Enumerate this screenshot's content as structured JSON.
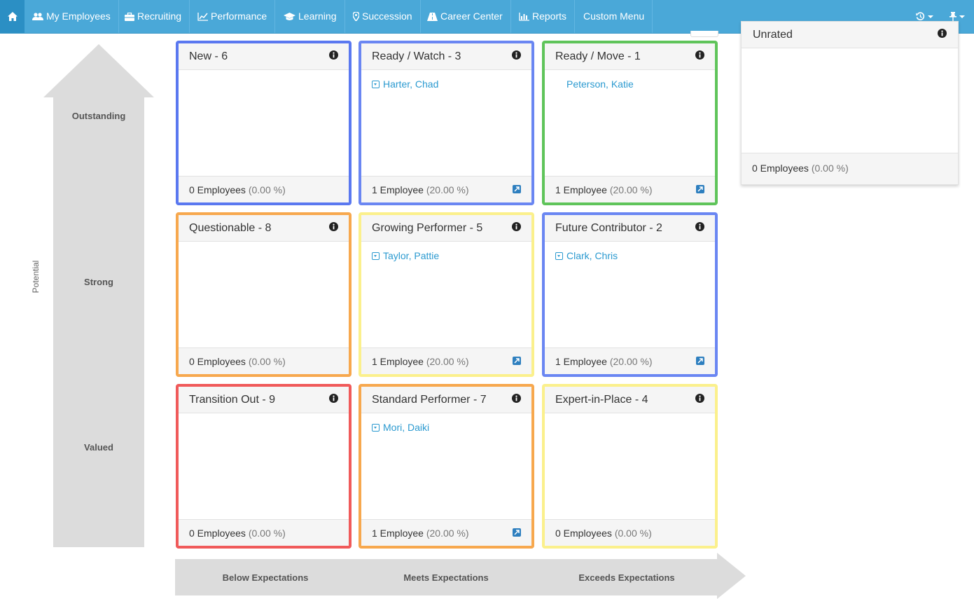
{
  "nav": {
    "items": [
      {
        "label": "My Employees",
        "icon": "users-icon"
      },
      {
        "label": "Recruiting",
        "icon": "briefcase-icon"
      },
      {
        "label": "Performance",
        "icon": "line-chart-icon"
      },
      {
        "label": "Learning",
        "icon": "graduation-cap-icon"
      },
      {
        "label": "Succession",
        "icon": "map-marker-icon"
      },
      {
        "label": "Career Center",
        "icon": "road-icon"
      },
      {
        "label": "Reports",
        "icon": "bar-chart-icon"
      },
      {
        "label": "Custom Menu",
        "icon": ""
      }
    ]
  },
  "axis": {
    "vertical_title": "Potential",
    "levels": [
      "Outstanding",
      "Strong",
      "Valued"
    ],
    "performance_levels": [
      "Below Expectations",
      "Meets Expectations",
      "Exceeds Expectations"
    ]
  },
  "grid": [
    {
      "title": "New - 6",
      "color": "#5a78f0",
      "employee": "",
      "count": "0 Employees",
      "pct": "(0.00 %)"
    },
    {
      "title": "Ready / Watch - 3",
      "color": "#6a86f2",
      "employee": "Harter, Chad",
      "count": "1 Employee",
      "pct": "(20.00 %)"
    },
    {
      "title": "Ready / Move - 1",
      "color": "#5fc45a",
      "employee": "Peterson, Katie",
      "count": "1 Employee",
      "pct": "(20.00 %)"
    },
    {
      "title": "Questionable - 8",
      "color": "#f7a84e",
      "employee": "",
      "count": "0 Employees",
      "pct": "(0.00 %)"
    },
    {
      "title": "Growing Performer - 5",
      "color": "#fbf08c",
      "employee": "Taylor, Pattie",
      "count": "1 Employee",
      "pct": "(20.00 %)"
    },
    {
      "title": "Future Contributor - 2",
      "color": "#6a86f2",
      "employee": "Clark, Chris",
      "count": "1 Employee",
      "pct": "(20.00 %)"
    },
    {
      "title": "Transition Out - 9",
      "color": "#f05a5a",
      "employee": "",
      "count": "0 Employees",
      "pct": "(0.00 %)"
    },
    {
      "title": "Standard Performer - 7",
      "color": "#f7a84e",
      "employee": "Mori, Daiki",
      "count": "1 Employee",
      "pct": "(20.00 %)"
    },
    {
      "title": "Expert-in-Place - 4",
      "color": "#fbf08c",
      "employee": "",
      "count": "0 Employees",
      "pct": "(0.00 %)"
    }
  ],
  "unrated": {
    "title": "Unrated",
    "count": "0 Employees",
    "pct": "(0.00 %)"
  }
}
